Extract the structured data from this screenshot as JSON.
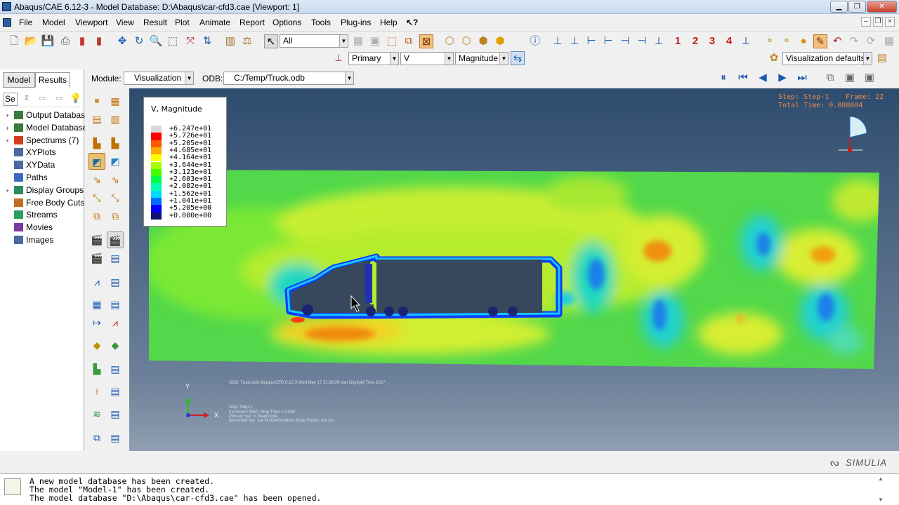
{
  "window": {
    "title": "Abaqus/CAE 6.12-3 - Model Database: D:\\Abaqus\\car-cfd3.cae [Viewport: 1]"
  },
  "menu": [
    "File",
    "Model",
    "Viewport",
    "View",
    "Result",
    "Plot",
    "Animate",
    "Report",
    "Options",
    "Tools",
    "Plug-ins",
    "Help"
  ],
  "toolbar1": {
    "selection_filter": "All",
    "viewport_numbers": [
      "1",
      "2",
      "3",
      "4"
    ]
  },
  "toolbar2": {
    "field_output_type": "Primary",
    "field_variable": "V",
    "field_invariant": "Magnitude",
    "options_combo": "Visualization defaults"
  },
  "context": {
    "module_label": "Module:",
    "module_value": "Visualization",
    "odb_label": "ODB:",
    "odb_value": "C:/Temp/Truck.odb"
  },
  "panel": {
    "tabs": [
      "Model",
      "Results"
    ],
    "active_tab": "Results",
    "filter_value": "Se",
    "tree": [
      {
        "label": "Output Databases",
        "expand": "+",
        "icon": "database-icon"
      },
      {
        "label": "Model Databases",
        "expand": "+",
        "icon": "database-icon"
      },
      {
        "label": "Spectrums (7)",
        "expand": "+",
        "icon": "spectrum-icon"
      },
      {
        "label": "XYPlots",
        "expand": "",
        "icon": "grid-icon"
      },
      {
        "label": "XYData",
        "expand": "",
        "icon": "grid-icon"
      },
      {
        "label": "Paths",
        "expand": "",
        "icon": "path-icon"
      },
      {
        "label": "Display Groups",
        "expand": "+",
        "icon": "display-group-icon"
      },
      {
        "label": "Free Body Cuts",
        "expand": "",
        "icon": "cut-icon"
      },
      {
        "label": "Streams",
        "expand": "",
        "icon": "stream-icon"
      },
      {
        "label": "Movies",
        "expand": "",
        "icon": "movie-icon"
      },
      {
        "label": "Images",
        "expand": "",
        "icon": "image-icon"
      }
    ]
  },
  "legend": {
    "title": "V, Magnitude",
    "entries": [
      {
        "value": "+6.247e+01",
        "color": "#d9d9d9"
      },
      {
        "value": "+5.726e+01",
        "color": "#ff0000"
      },
      {
        "value": "+5.205e+01",
        "color": "#ff5a00"
      },
      {
        "value": "+4.685e+01",
        "color": "#ffa800"
      },
      {
        "value": "+4.164e+01",
        "color": "#ffff00"
      },
      {
        "value": "+3.644e+01",
        "color": "#a6ff00"
      },
      {
        "value": "+3.123e+01",
        "color": "#43ff00"
      },
      {
        "value": "+2.603e+01",
        "color": "#00ff48"
      },
      {
        "value": "+2.082e+01",
        "color": "#00ffb0"
      },
      {
        "value": "+1.562e+01",
        "color": "#00d8ff"
      },
      {
        "value": "+1.041e+01",
        "color": "#006cff"
      },
      {
        "value": "+5.205e+00",
        "color": "#0000ff"
      },
      {
        "value": "+0.000e+00",
        "color": "#101070"
      }
    ]
  },
  "step_info": {
    "step": "Step: Step-1",
    "frame": "Frame: 22",
    "total_time": "Total Time: 0.088004"
  },
  "vp_info": {
    "odb_line": "ODB: Truck.odb    Abaqus/CFD 6.12-3    Wed May 17 22:38:29 Iran Daylight Time 2017",
    "step_line": "Step: Step-1",
    "increment_line": "Increment   3950: Step Time =     0.088",
    "primary_line": "Primary Var: V, Magnitude",
    "deformed_line": "Deformed Var: not set   Deformation Scale Factor: not set"
  },
  "triad": {
    "x": "X",
    "y": "Y"
  },
  "brand": "SIMULIA",
  "messages": [
    "A new model database has been created.",
    "The model \"Model-1\" has been created.",
    "The model database \"D:\\Abaqus\\car-cfd3.cae\" has been opened."
  ]
}
